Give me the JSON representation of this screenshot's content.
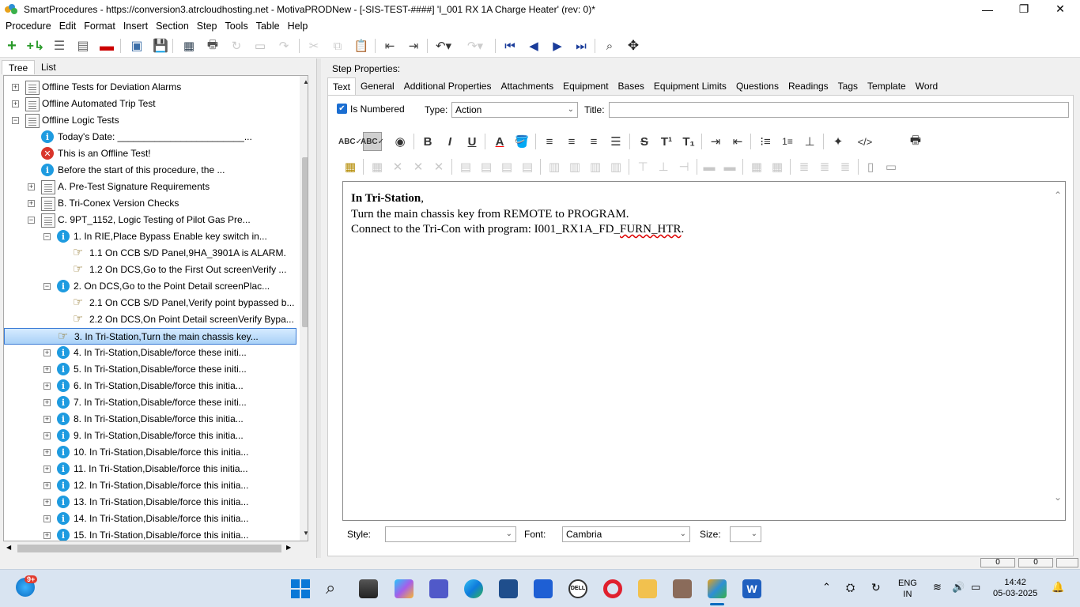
{
  "window": {
    "title": "SmartProcedures - https://conversion3.atrcloudhosting.net - MotivaPRODNew - [-SIS-TEST-####] 'I_001 RX 1A Charge Heater' (rev: 0)*",
    "minimize": "—",
    "maximize": "❐",
    "close": "✕"
  },
  "menu": [
    "Procedure",
    "Edit",
    "Format",
    "Insert",
    "Section",
    "Step",
    "Tools",
    "Table",
    "Help"
  ],
  "left_tabs": [
    "Tree",
    "List"
  ],
  "tree": [
    {
      "text": "Offline Tests for Deviation Alarms",
      "icon": "doc",
      "expander": "+"
    },
    {
      "text": "Offline Automated Trip Test",
      "icon": "doc",
      "expander": "+"
    },
    {
      "text": "Offline Logic Tests",
      "icon": "doc",
      "expander": "−"
    },
    {
      "text": "Today's Date: ________________________...",
      "icon": "info",
      "expander": ""
    },
    {
      "text": "This is an Offline Test!",
      "icon": "error",
      "expander": ""
    },
    {
      "text": "Before the start of this procedure, the ...",
      "icon": "info",
      "expander": ""
    },
    {
      "text": "A. Pre-Test Signature Requirements",
      "icon": "doc",
      "expander": "+"
    },
    {
      "text": "B. Tri-Conex Version Checks",
      "icon": "doc",
      "expander": "+"
    },
    {
      "text": "C. 9PT_1152, Logic Testing of Pilot Gas Pre...",
      "icon": "doc",
      "expander": "−"
    },
    {
      "text": "1. In RIE,Place Bypass Enable key switch in...",
      "icon": "info",
      "expander": "−"
    },
    {
      "text": "1.1 On CCB S/D Panel,9HA_3901A is ALARM.",
      "icon": "hand",
      "expander": ""
    },
    {
      "text": "1.2 On DCS,Go to the First Out screenVerify ...",
      "icon": "hand",
      "expander": ""
    },
    {
      "text": "2. On DCS,Go to the Point Detail screenPlac...",
      "icon": "info",
      "expander": "−"
    },
    {
      "text": "2.1 On CCB S/D Panel,Verify point bypassed b...",
      "icon": "hand",
      "expander": ""
    },
    {
      "text": "2.2 On DCS,On Point Detail screenVerify Bypa...",
      "icon": "hand",
      "expander": ""
    },
    {
      "text": "3. In Tri-Station,Turn the main chassis key...",
      "icon": "hand",
      "expander": "",
      "selected": true
    },
    {
      "text": "4. In Tri-Station,Disable/force these initi...",
      "icon": "info",
      "expander": "+"
    },
    {
      "text": "5. In Tri-Station,Disable/force these initi...",
      "icon": "info",
      "expander": "+"
    },
    {
      "text": "6. In Tri-Station,Disable/force this initia...",
      "icon": "info",
      "expander": "+"
    },
    {
      "text": "7. In Tri-Station,Disable/force these initi...",
      "icon": "info",
      "expander": "+"
    },
    {
      "text": "8. In Tri-Station,Disable/force this initia...",
      "icon": "info",
      "expander": "+"
    },
    {
      "text": "9. In Tri-Station,Disable/force this initia...",
      "icon": "info",
      "expander": "+"
    },
    {
      "text": "10. In Tri-Station,Disable/force this initia...",
      "icon": "info",
      "expander": "+"
    },
    {
      "text": "11. In Tri-Station,Disable/force this initia...",
      "icon": "info",
      "expander": "+"
    },
    {
      "text": "12. In Tri-Station,Disable/force this initia...",
      "icon": "info",
      "expander": "+"
    },
    {
      "text": "13. In Tri-Station,Disable/force this initia...",
      "icon": "info",
      "expander": "+"
    },
    {
      "text": "14. In Tri-Station,Disable/force this initia...",
      "icon": "info",
      "expander": "+"
    },
    {
      "text": "15. In Tri-Station,Disable/force this initia...",
      "icon": "info",
      "expander": "+"
    }
  ],
  "step_props_label": "Step Properties:",
  "right_tabs": [
    "Text",
    "General",
    "Additional Properties",
    "Attachments",
    "Equipment",
    "Bases",
    "Equipment Limits",
    "Questions",
    "Readings",
    "Tags",
    "Template",
    "Word"
  ],
  "is_numbered_label": "Is Numbered",
  "type_label": "Type:",
  "type_value": "Action",
  "title_label": "Title:",
  "editor": {
    "line1_bold": "In Tri-Station",
    "line1_rest": ",",
    "line2": "Turn the main chassis key from REMOTE to PROGRAM.",
    "line3_a": "Connect to the Tri-Con with program: I001_RX1A_FD_",
    "line3_b": "FURN_HTR",
    "line3_c": "."
  },
  "style_label": "Style:",
  "font_label": "Font:",
  "font_value": "Cambria",
  "size_label": "Size:",
  "taskbar": {
    "badge": "9+",
    "lang1": "ENG",
    "lang2": "IN",
    "time": "14:42",
    "date": "05-03-2025"
  },
  "status_box1": "0",
  "status_box2": "0"
}
